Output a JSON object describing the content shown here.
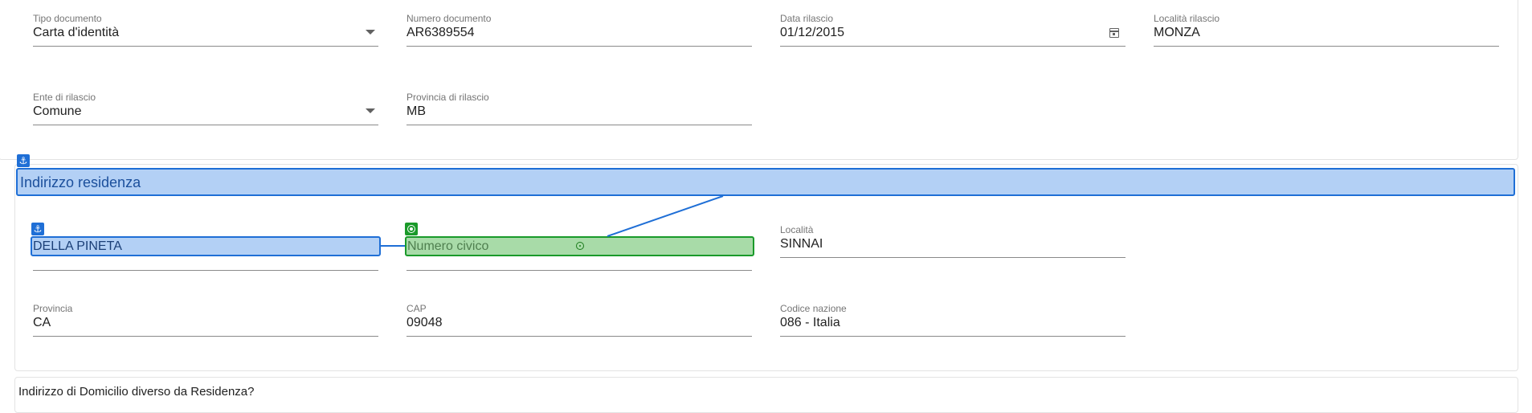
{
  "document": {
    "tipo_documento": {
      "label": "Tipo documento",
      "value": "Carta d'identità"
    },
    "numero_documento": {
      "label": "Numero documento",
      "value": "AR6389554"
    },
    "data_rilascio": {
      "label": "Data rilascio",
      "value": "01/12/2015"
    },
    "localita_rilascio": {
      "label": "Località rilascio",
      "value": "MONZA"
    },
    "ente_rilascio": {
      "label": "Ente di rilascio",
      "value": "Comune"
    },
    "provincia_rilascio": {
      "label": "Provincia di rilascio",
      "value": "MB"
    }
  },
  "residenza": {
    "title": "Indirizzo residenza",
    "via": {
      "value": "DELLA PINETA"
    },
    "numero_civico": {
      "placeholder": "Numero civico"
    },
    "localita": {
      "label": "Località",
      "value": "SINNAI"
    },
    "provincia": {
      "label": "Provincia",
      "value": "CA"
    },
    "cap": {
      "label": "CAP",
      "value": "09048"
    },
    "codice_nazione": {
      "label": "Codice nazione",
      "value": "086 - Italia"
    }
  },
  "domicilio": {
    "question": "Indirizzo di Domicilio diverso da Residenza?"
  },
  "icons": {
    "anchor": "⚓",
    "target": "target-icon",
    "crosshair": "crosshair-icon",
    "dropdown": "chevron-down-icon",
    "calendar": "calendar-icon"
  },
  "colors": {
    "highlight_blue": "#b3d0f5",
    "highlight_blue_border": "#1f6fd6",
    "highlight_green": "#a8dba8",
    "highlight_green_border": "#1a9a2a"
  }
}
